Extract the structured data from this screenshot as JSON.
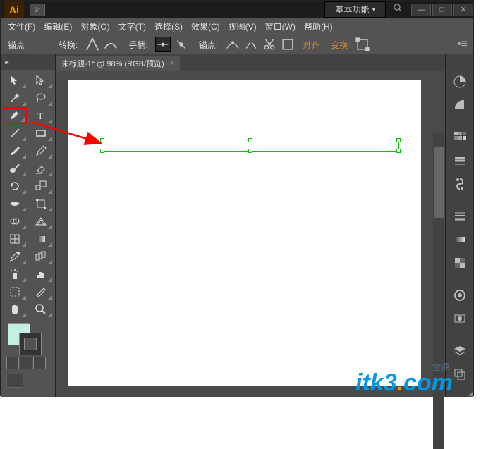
{
  "title": {
    "ai": "Ai",
    "br": "Br",
    "essentials": "基本功能"
  },
  "winbtns": {
    "min": "—",
    "max": "□",
    "close": "✕"
  },
  "menu": [
    "文件(F)",
    "编辑(E)",
    "对象(O)",
    "文字(T)",
    "选择(S)",
    "效果(C)",
    "视图(V)",
    "窗口(W)",
    "帮助(H)"
  ],
  "control": {
    "anchor": "锚点",
    "convert": "转换:",
    "handles": "手柄:",
    "anchors": "锚点:",
    "align": "对齐",
    "transform": "变换"
  },
  "doc": {
    "tab": "未标题-1* @ 98% (RGB/预览)",
    "close": "×"
  },
  "watermark": {
    "itk": "itk3",
    "dot": ".",
    "com": "com",
    "chn": "一堂课"
  }
}
